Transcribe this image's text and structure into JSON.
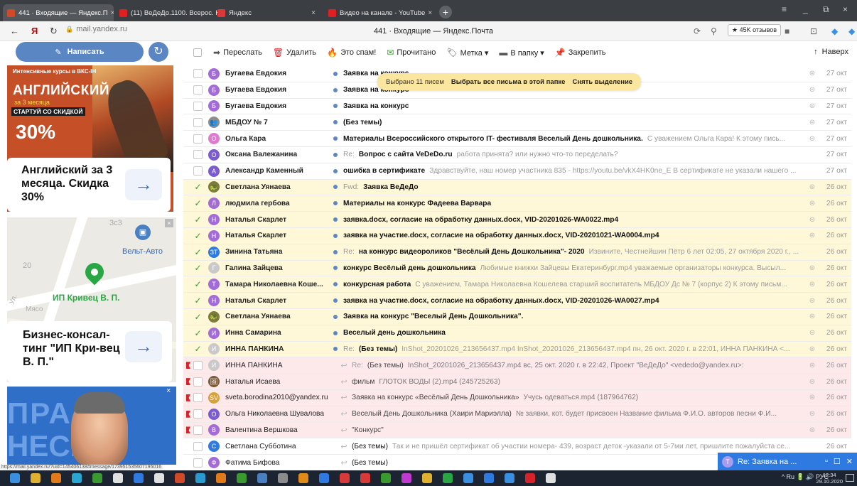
{
  "colors": {
    "accent": "#5b86c4",
    "selected_row": "#fff8d8",
    "pinned_row": "#fde9ea",
    "tooltip": "#fbe69f",
    "flag": "#d6232a",
    "check": "#3a9a2f"
  },
  "browser": {
    "tabs": [
      {
        "label": "441 · Входящие — Яндекс.П",
        "close": "×",
        "icon": "mail-icon",
        "color": "#d04a2a"
      },
      {
        "label": "(11) ВеДеДо.1100. Всерос. К",
        "close": "×",
        "icon": "youtube-icon",
        "color": "#e02020"
      },
      {
        "label": "Яндекс",
        "close": "×",
        "icon": "yandex-icon",
        "color": "#d83a3a"
      },
      {
        "label": "Видео на канале - YouTube",
        "close": "×",
        "icon": "youtube-icon",
        "color": "#e02020"
      }
    ],
    "new_tab": "+",
    "back": "←",
    "yandex_logo": "Я",
    "reload": "↻",
    "lock": "🔒",
    "url": "mail.yandex.ru",
    "page_title": "441 · Входящие — Яндекс.Почта",
    "reviews": "★ 45K отзывов",
    "window_controls": [
      "≡",
      "_",
      "⧉",
      "×"
    ]
  },
  "sidebar": {
    "compose_label": "Написать",
    "compose_icon": "✎",
    "refresh_icon": "↻"
  },
  "ads": {
    "ad1": {
      "top": "Интенсивные курсы в ВКС-IH",
      "headline": "АНГЛИЙСКИЙ",
      "sub": "за 3 месяца",
      "badge": "СТАРТУЙ СО СКИДКОЙ",
      "percent": "30%",
      "card_title": "Английский за 3 месяца. Скидка 30%",
      "arrow": "→"
    },
    "ad2": {
      "label_blue": "Вельт-Авто",
      "label_green": "ИП Кривец В. П.",
      "num1": "3с3",
      "num2": "20",
      "street": "Ул.",
      "street2": "Мясо",
      "close": "×",
      "card_title": "Бизнес-консал-тинг \"ИП Кри-вец В. П.\"",
      "arrow": "→"
    },
    "ad3": {
      "text": "ПРА ИЧ",
      "text2": "НЕСК",
      "close": "×"
    }
  },
  "status_url": "https://mail.yandex.ru/?uid=145406138#message/173951535607195016",
  "toolbar": {
    "forward": "Переслать",
    "delete": "Удалить",
    "spam": "Это спам!",
    "read": "Прочитано",
    "label": "Метка ▾",
    "folder": "В папку ▾",
    "pin": "Закрепить",
    "top": "Наверх"
  },
  "tooltip": {
    "count": "Выбрано 11 писем",
    "select_all": "Выбрать все письма в этой папке",
    "deselect": "Снять выделение"
  },
  "messages": [
    {
      "sender": "Бугаева Евдокия",
      "initial": "Б",
      "avatar_color": "#a36bd8",
      "subject": "Заявка на конкурс",
      "relation": "",
      "snippet": "",
      "date": "27 окт",
      "state": "normal",
      "checked": false,
      "unread": true,
      "clip": true
    },
    {
      "sender": "Бугаева Евдокия",
      "initial": "Б",
      "avatar_color": "#a36bd8",
      "subject": "Заявка на конкурс",
      "relation": "",
      "snippet": "",
      "date": "27 окт",
      "state": "normal",
      "checked": false,
      "unread": true,
      "clip": true
    },
    {
      "sender": "Бугаева Евдокия",
      "initial": "Б",
      "avatar_color": "#a36bd8",
      "subject": "Заявка на конкурс",
      "relation": "",
      "snippet": "",
      "date": "27 окт",
      "state": "normal",
      "checked": false,
      "unread": true,
      "clip": true
    },
    {
      "sender": "МБДОУ № 7",
      "initial": "👥",
      "avatar_color": "#8c8c8c",
      "subject": "(Без темы)",
      "relation": "",
      "snippet": "",
      "date": "27 окт",
      "state": "normal",
      "checked": false,
      "unread": true,
      "clip": true
    },
    {
      "sender": "Ольга Кара",
      "initial": "О",
      "avatar_color": "#e07ad0",
      "subject": "Материалы Всероссийского открытого IT- фестиваля Веселый День дошкольника.",
      "relation": "",
      "snippet": "С уважением Ольга Кара! К этому пись...",
      "date": "27 окт",
      "state": "normal",
      "checked": false,
      "unread": true,
      "clip": true
    },
    {
      "sender": "Оксана Валежанина",
      "initial": "О",
      "avatar_color": "#7a5bd0",
      "subject": "Вопрос с сайта VeDeDo.ru",
      "relation": "Re:",
      "snippet": "работа принята? или нужно что-то переделать?",
      "date": "27 окт",
      "state": "normal",
      "checked": false,
      "unread": true,
      "clip": false
    },
    {
      "sender": "Александр Каменный",
      "initial": "А",
      "avatar_color": "#7a5bd0",
      "subject": "ошибка в сертификате",
      "relation": "",
      "snippet": "Здравствуйте, наш номер участника 835 - https://youtu.be/vkX4HK0ne_E В сертификате не указали нашего ...",
      "date": "27 окт",
      "state": "normal",
      "checked": false,
      "unread": true,
      "clip": false
    },
    {
      "sender": "Светлана Уянаева",
      "initial": "🐢",
      "avatar_color": "#7d7a3a",
      "subject": "Заявка ВеДеДо",
      "relation": "Fwd:",
      "snippet": "",
      "date": "26 окт",
      "state": "selected",
      "checked": true,
      "unread": true,
      "clip": true
    },
    {
      "sender": "людмила гербова",
      "initial": "Л",
      "avatar_color": "#a36bd8",
      "subject": "Материалы на конкурс Фадеева Варвара",
      "relation": "",
      "snippet": "",
      "date": "26 окт",
      "state": "selected",
      "checked": true,
      "unread": true,
      "clip": true
    },
    {
      "sender": "Наталья Скарлет",
      "initial": "Н",
      "avatar_color": "#a36bd8",
      "subject": "заявка.docx, согласие на обработку данных.docx, VID-20201026-WA0022.mp4",
      "relation": "",
      "snippet": "",
      "date": "26 окт",
      "state": "selected",
      "checked": true,
      "unread": true,
      "clip": true
    },
    {
      "sender": "Наталья Скарлет",
      "initial": "Н",
      "avatar_color": "#a36bd8",
      "subject": "заявка на участие.docx, согласие на обработку данных.docx, VID-20201021-WA0004.mp4",
      "relation": "",
      "snippet": "",
      "date": "26 окт",
      "state": "selected",
      "checked": true,
      "unread": true,
      "clip": true
    },
    {
      "sender": "Зинина Татьяна",
      "initial": "ЗТ",
      "avatar_color": "#2f7ae0",
      "subject": "на конкурс видеороликов \"Весёлый День Дошкольника\"- 2020",
      "relation": "Re:",
      "snippet": "Извините, Честнейшин Пётр 6 лет 02:05, 27 октября 2020 г., ...",
      "date": "26 окт",
      "state": "selected",
      "checked": true,
      "unread": true,
      "clip": false
    },
    {
      "sender": "Галина Зайцева",
      "initial": "Г",
      "avatar_color": "#c9c9c9",
      "subject": "конкурс Весёлый день дошкольника",
      "relation": "",
      "snippet": "Любимые книжки Зайцевы Екатеринбург.mp4 уважаемые организаторы конкурса. Высыл...",
      "date": "26 окт",
      "state": "selected",
      "checked": true,
      "unread": true,
      "clip": true
    },
    {
      "sender": "Тамара Николаевна Коше...",
      "initial": "Т",
      "avatar_color": "#a36bd8",
      "subject": "конкурсная работа",
      "relation": "",
      "snippet": "С уважением, Тамара Николаевна Кошелева старший воспитатель МБДОУ Дс № 7 (корпус 2) К этому письм...",
      "date": "26 окт",
      "state": "selected",
      "checked": true,
      "unread": true,
      "clip": true
    },
    {
      "sender": "Наталья Скарлет",
      "initial": "Н",
      "avatar_color": "#a36bd8",
      "subject": "заявка на участие.docx, согласие на обработку данных.docx, VID-20201026-WA0027.mp4",
      "relation": "",
      "snippet": "",
      "date": "26 окт",
      "state": "selected",
      "checked": true,
      "unread": true,
      "clip": true
    },
    {
      "sender": "Светлана Уянаева",
      "initial": "🐢",
      "avatar_color": "#7d7a3a",
      "subject": "Заявка на конкурс \"Веселый День Дошкольника\".",
      "relation": "",
      "snippet": "",
      "date": "26 окт",
      "state": "selected",
      "checked": true,
      "unread": true,
      "clip": true
    },
    {
      "sender": "Инна Самарина",
      "initial": "И",
      "avatar_color": "#a36bd8",
      "subject": "Веселый день дошкольника",
      "relation": "",
      "snippet": "",
      "date": "26 окт",
      "state": "selected",
      "checked": true,
      "unread": true,
      "clip": true
    },
    {
      "sender": "ИННА ПАНКИНА",
      "initial": "И",
      "avatar_color": "#c9c9c9",
      "subject": "(Без темы)",
      "relation": "Re:",
      "snippet": "InShot_20201026_213656437.mp4 InShot_20201026_213656437.mp4 пн, 26 окт. 2020 г. в 22:01, ИННА ПАНКИНА <...",
      "date": "26 окт",
      "state": "selected",
      "checked": true,
      "unread": true,
      "clip": true
    },
    {
      "sender": "ИННА ПАНКИНА",
      "initial": "И",
      "avatar_color": "#c9c9c9",
      "subject": "(Без темы)",
      "relation": "Re:",
      "snippet": "InShot_20201026_213656437.mp4 вс, 25 окт. 2020 г. в 22:42, Проект \"ВеДеДо\" <vededo@yandex.ru>:",
      "date": "26 окт",
      "state": "pinned",
      "checked": false,
      "unread": false,
      "clip": true
    },
    {
      "sender": "Наталья Исаева",
      "initial": "🖼",
      "avatar_color": "#7b5a3a",
      "subject": "фильм",
      "relation": "",
      "snippet": "ГЛОТОК ВОДЫ (2).mp4 (245725263)",
      "date": "26 окт",
      "state": "pinned",
      "checked": false,
      "unread": false,
      "clip": true
    },
    {
      "sender": "sveta.borodina2010@yandex.ru",
      "initial": "SV",
      "avatar_color": "#d7a23a",
      "subject": "Заявка на конкурс «Весёлый День Дошкольника»",
      "relation": "",
      "snippet": "Учусь одеваться.mp4 (187964762)",
      "date": "26 окт",
      "state": "pinned",
      "checked": false,
      "unread": false,
      "clip": true
    },
    {
      "sender": "Ольга Николаевна Шувалова",
      "initial": "О",
      "avatar_color": "#7a5bd0",
      "subject": "Веселый День Дошкольника (Хаири Мариэлла)",
      "relation": "",
      "snippet": "№ заявки, кот. будет присвоен Название фильма Ф.И.О. авторов песни Ф.И...",
      "date": "26 окт",
      "state": "pinned",
      "checked": false,
      "unread": false,
      "clip": true
    },
    {
      "sender": "Валентина Вершкова",
      "initial": "В",
      "avatar_color": "#a36bd8",
      "subject": "\"Конкурс\"",
      "relation": "",
      "snippet": "",
      "date": "26 окт",
      "state": "pinned",
      "checked": false,
      "unread": false,
      "clip": true
    },
    {
      "sender": "Светлана Субботина",
      "initial": "С",
      "avatar_color": "#2f7ae0",
      "subject": "(Без темы)",
      "relation": "",
      "snippet": "Так и не пришёл сертификат об участии номера- 439, возраст деток -указали от 5-7ми лет, пришлите пожалуйста се...",
      "date": "26 окт",
      "state": "normal",
      "checked": false,
      "unread": false,
      "clip": false
    },
    {
      "sender": "Фатима Бифова",
      "initial": "Ф",
      "avatar_color": "#a36bd8",
      "subject": "(Без темы)",
      "relation": "",
      "snippet": "",
      "date": "",
      "state": "normal",
      "checked": false,
      "unread": false,
      "clip": false
    }
  ],
  "notification": {
    "initial": "T",
    "text": "Re: Заявка на ...",
    "minimize": "▫",
    "restore": "☐",
    "close": "✕"
  },
  "taskbar": {
    "tray": "^ Ru 🔋 🔊 РУС",
    "time": "12:34",
    "date": "29.10.2020"
  }
}
